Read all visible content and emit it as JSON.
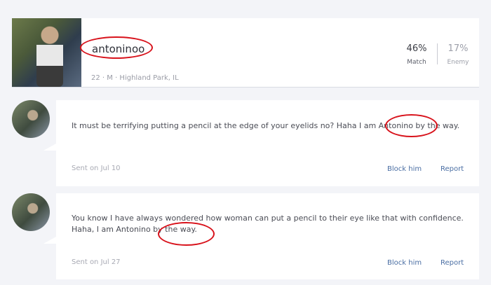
{
  "profile": {
    "username": "antoninoo",
    "meta": "22 · M · Highland Park, IL",
    "match": {
      "value": "46%",
      "label": "Match"
    },
    "enemy": {
      "value": "17%",
      "label": "Enemy"
    }
  },
  "messages": [
    {
      "text": "It must be terrifying putting a pencil at the edge of your eyelids no? Haha I am Antonino by the way.",
      "date": "Sent on Jul 10",
      "block_label": "Block him",
      "report_label": "Report"
    },
    {
      "text": "You know I have always wondered how woman can put a pencil to their eye like that with confidence. Haha, I am Antonino by the way.",
      "date": "Sent on Jul 27",
      "block_label": "Block him",
      "report_label": "Report"
    }
  ],
  "colors": {
    "background": "#f3f4f8",
    "card": "#ffffff",
    "link": "#4a6ea3",
    "annotation": "#d8121b"
  }
}
